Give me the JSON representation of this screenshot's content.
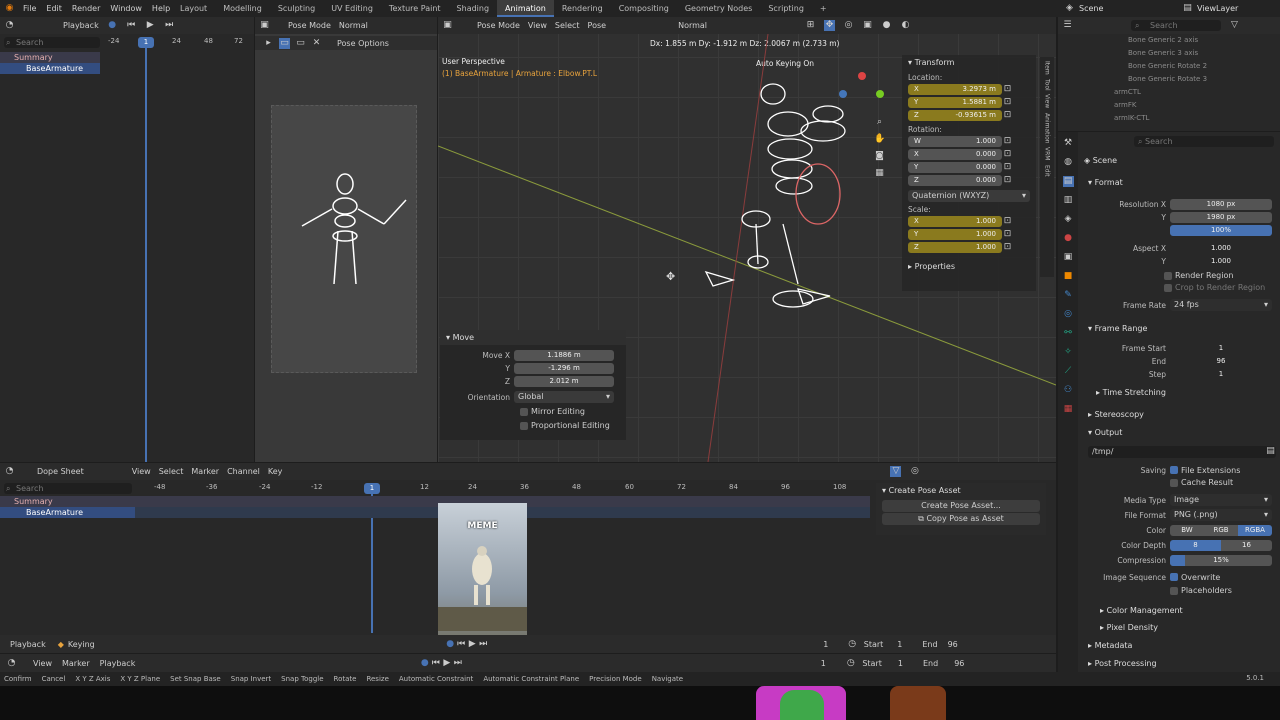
{
  "topbar": {
    "menus": [
      "File",
      "Edit",
      "Render",
      "Window",
      "Help"
    ],
    "workspaces": [
      "Layout",
      "Modelling",
      "Sculpting",
      "UV Editing",
      "Texture Paint",
      "Shading",
      "Animation",
      "Rendering",
      "Compositing",
      "Geometry Nodes",
      "Scripting"
    ],
    "active_workspace": "Animation",
    "add_tab": "+",
    "scene_label": "Scene",
    "viewlayer_label": "ViewLayer"
  },
  "left_editor": {
    "mode": "Playback",
    "search_placeholder": "Search",
    "ticks": [
      "-24",
      "0",
      "24",
      "48",
      "72"
    ],
    "current_frame": "1",
    "rows": [
      "Summary",
      "BaseArmature"
    ]
  },
  "camera_view": {
    "mode": "Pose Mode",
    "orientation": "Normal",
    "pose_options": "Pose Options"
  },
  "viewport": {
    "mode": "Pose Mode",
    "menus": [
      "View",
      "Select",
      "Pose"
    ],
    "orientation": "Normal",
    "delta_readout": "Dx: 1.855 m  Dy: -1.912 m  Dz: 2.0067 m (2.733 m)",
    "perspective": "User Perspective",
    "object_info": "(1) BaseArmature | Armature : Elbow.PT.L",
    "auto_keying": "Auto Keying On",
    "transform": {
      "title": "Transform",
      "location_label": "Location:",
      "location": [
        {
          "axis": "X",
          "value": "3.2973 m"
        },
        {
          "axis": "Y",
          "value": "1.5881 m"
        },
        {
          "axis": "Z",
          "value": "-0.93615 m"
        }
      ],
      "rotation_label": "Rotation:",
      "rotation": [
        {
          "axis": "W",
          "value": "1.000"
        },
        {
          "axis": "X",
          "value": "0.000"
        },
        {
          "axis": "Y",
          "value": "0.000"
        },
        {
          "axis": "Z",
          "value": "0.000"
        }
      ],
      "rotation_mode": "Quaternion (WXYZ)",
      "scale_label": "Scale:",
      "scale": [
        {
          "axis": "X",
          "value": "1.000"
        },
        {
          "axis": "Y",
          "value": "1.000"
        },
        {
          "axis": "Z",
          "value": "1.000"
        }
      ],
      "properties": "Properties"
    },
    "side_tabs": [
      "Item",
      "Tool",
      "View",
      "Animation",
      "VRM",
      "Edit"
    ],
    "move_panel": {
      "title": "Move",
      "move_x_label": "Move X",
      "move_x": "1.1886 m",
      "y_label": "Y",
      "y": "-1.296 m",
      "z_label": "Z",
      "z": "2.012 m",
      "orientation_label": "Orientation",
      "orientation": "Global",
      "mirror": "Mirror Editing",
      "proportional": "Proportional Editing"
    }
  },
  "outliner": {
    "search_placeholder": "Search",
    "items": [
      "Bone Generic 2 axis",
      "Bone Generic 3 axis",
      "Bone Generic Rotate 2",
      "Bone Generic Rotate 3",
      "armCTL",
      "armFK",
      "armIK-CTL"
    ]
  },
  "properties": {
    "search_placeholder": "Search",
    "scene_label": "Scene",
    "format": {
      "title": "Format",
      "res_x_label": "Resolution X",
      "res_x": "1080 px",
      "res_y_label": "Y",
      "res_y": "1980 px",
      "res_pct": "100%",
      "aspect_x_label": "Aspect X",
      "aspect_x": "1.000",
      "aspect_y_label": "Y",
      "aspect_y": "1.000",
      "render_region": "Render Region",
      "crop": "Crop to Render Region",
      "frame_rate_label": "Frame Rate",
      "frame_rate": "24 fps"
    },
    "frame_range": {
      "title": "Frame Range",
      "start_label": "Frame Start",
      "start": "1",
      "end_label": "End",
      "end": "96",
      "step_label": "Step",
      "step": "1",
      "time_stretching": "Time Stretching"
    },
    "stereoscopy": "Stereoscopy",
    "output": {
      "title": "Output",
      "path": "/tmp/",
      "saving_label": "Saving",
      "file_ext": "File Extensions",
      "cache_result": "Cache Result",
      "media_type_label": "Media Type",
      "media_type": "Image",
      "file_format_label": "File Format",
      "file_format": "PNG (.png)",
      "color_label": "Color",
      "color_options": [
        "BW",
        "RGB",
        "RGBA"
      ],
      "depth_label": "Color Depth",
      "depth_options": [
        "8",
        "16"
      ],
      "compression_label": "Compression",
      "compression": "15%",
      "compression_level": 0.15,
      "img_seq_label": "Image Sequence",
      "overwrite": "Overwrite",
      "placeholders": "Placeholders"
    },
    "color_management": "Color Management",
    "pixel_density": "Pixel Density",
    "metadata": "Metadata",
    "post_processing": "Post Processing"
  },
  "dopesheet": {
    "mode": "Dope Sheet",
    "menus": [
      "View",
      "Select",
      "Marker",
      "Channel",
      "Key"
    ],
    "search_placeholder": "Search",
    "ticks": [
      "-48",
      "-36",
      "-24",
      "-12",
      "0",
      "12",
      "24",
      "36",
      "48",
      "60",
      "72",
      "84",
      "96",
      "108"
    ],
    "current_frame": "1",
    "rows": [
      "Summary",
      "BaseArmature"
    ],
    "meme_text": "MEME",
    "pose_panel": {
      "title": "Create Pose Asset",
      "create_btn": "Create Pose Asset...",
      "copy_btn": "Copy Pose as Asset"
    },
    "footer": {
      "playback": "Playback",
      "keying": "Keying",
      "frame": "1",
      "start_label": "Start",
      "start": "1",
      "end_label": "End",
      "end": "96"
    }
  },
  "timeline": {
    "menus": [
      "View",
      "Marker",
      "Playback"
    ],
    "frame": "1",
    "start_label": "Start",
    "start": "1",
    "end_label": "End",
    "end": "96"
  },
  "statusbar": {
    "items": [
      "Confirm",
      "Cancel",
      "X Y Z Axis",
      "X Y Z Plane",
      "Set Snap Base",
      "Snap Invert",
      "Snap Toggle",
      "Rotate",
      "Resize",
      "Automatic Constraint",
      "Automatic Constraint Plane",
      "Precision Mode",
      "Navigate"
    ],
    "version": "5.0.1"
  },
  "colors": {
    "accent": "#4772b3",
    "header": "#2b2b2b",
    "panel": "#282828"
  }
}
